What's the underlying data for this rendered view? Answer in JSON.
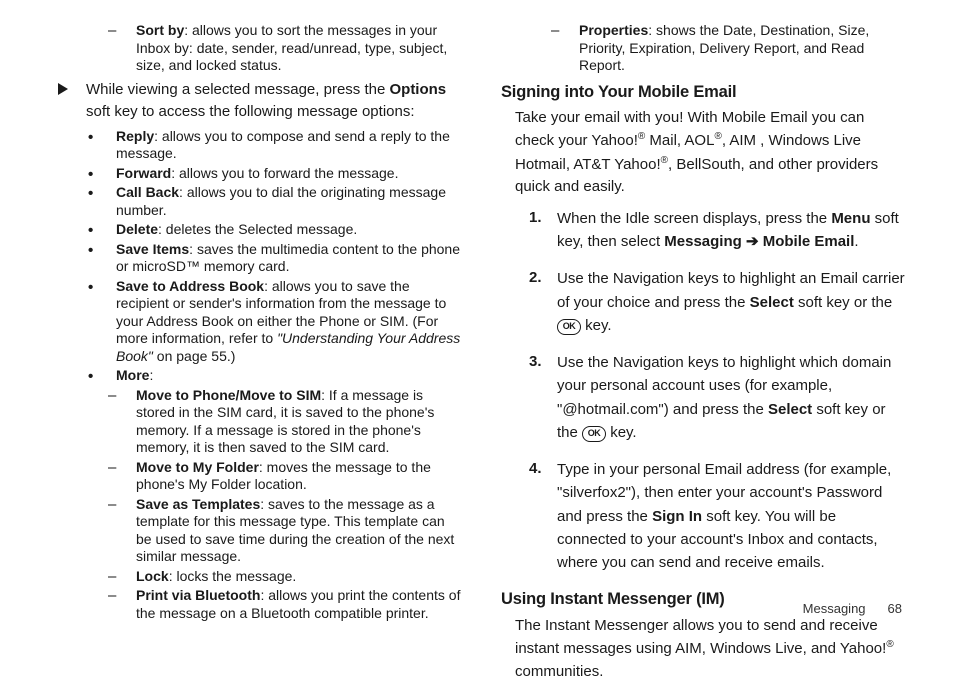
{
  "left": {
    "sortby": {
      "label": "Sort by",
      "text": ": allows you to sort the messages in your Inbox by: date, sender, read/unread, type, subject, size, and locked status."
    },
    "viewing_pre": "While viewing a selected message, press the ",
    "options_word": "Options",
    "viewing_post": " soft key to access the following message options:",
    "items": [
      {
        "label": "Reply",
        "text": ": allows you to compose and send a reply to the message."
      },
      {
        "label": "Forward",
        "text": ": allows you to forward the message."
      },
      {
        "label": "Call Back",
        "text": ": allows you to dial the originating message number."
      },
      {
        "label": "Delete",
        "text": ": deletes the Selected message."
      },
      {
        "label": "Save Items",
        "text": ": saves the multimedia content to the phone or microSD™ memory card."
      },
      {
        "label": "Save to Address Book",
        "text": ": allows you to save the recipient or sender's information from the message to your Address Book on either the Phone or SIM. (For more information, refer to ",
        "ital": "\"Understanding Your Address Book\"",
        "tail": "  on page 55.)"
      },
      {
        "label": "More",
        "text": ":"
      }
    ],
    "more": [
      {
        "label": "Move to Phone/Move to SIM",
        "text": ": If a message is stored in the SIM card, it is saved to the phone's memory. If a message is stored in the phone's memory, it is then saved to the SIM card."
      },
      {
        "label": "Move to My Folder",
        "text": ": moves the message to the phone's My Folder location."
      },
      {
        "label": "Save as Templates",
        "text": ": saves to the message as a template for this message type. This template can be used to save time during the creation of the next similar message."
      },
      {
        "label": "Lock",
        "text": ": locks the message."
      },
      {
        "label": "Print via Bluetooth",
        "text": ": allows you print the contents of the message on a Bluetooth compatible printer."
      }
    ]
  },
  "right": {
    "properties": {
      "label": "Properties",
      "text": ": shows the Date, Destination, Size, Priority, Expiration, Delivery Report, and Read Report."
    },
    "sign_heading": "Signing into Your Mobile Email",
    "sign_intro_1": "Take your email with you! With Mobile Email you can check your Yahoo!",
    "sign_intro_2": " Mail, AOL",
    "sign_intro_3": ", AIM , Windows Live Hotmail, AT&T Yahoo!",
    "sign_intro_4": ", BellSouth, and other providers quick and easily.",
    "reg": "®",
    "steps": [
      {
        "n": "1.",
        "parts": [
          "When the Idle screen displays, press the ",
          "Menu",
          " soft key, then select ",
          "Messaging ➔ Mobile Email",
          "."
        ]
      },
      {
        "n": "2.",
        "parts": [
          "Use the Navigation keys to highlight an Email carrier of your choice and press the ",
          "Select",
          " soft key or the  "
        ],
        "ok": true,
        "tail": " key."
      },
      {
        "n": "3.",
        "parts": [
          "Use the Navigation keys to highlight which domain your personal account uses (for example, \"@hotmail.com\") and press the ",
          "Select",
          " soft key or the  "
        ],
        "ok": true,
        "tail": " key."
      },
      {
        "n": "4.",
        "parts": [
          "Type in your personal Email address (for example, \"silverfox2\"), then enter your account's Password and press the ",
          "Sign In",
          " soft key. You will be connected to your account's Inbox and contacts, where you can send and receive emails."
        ]
      }
    ],
    "im_heading": "Using Instant Messenger (IM)",
    "im_body_1": "The Instant Messenger allows you to send and receive instant messages using AIM, Windows Live, and Yahoo!",
    "im_body_2": " communities."
  },
  "footer": {
    "section": "Messaging",
    "page": "68"
  },
  "ok_label": "OK"
}
